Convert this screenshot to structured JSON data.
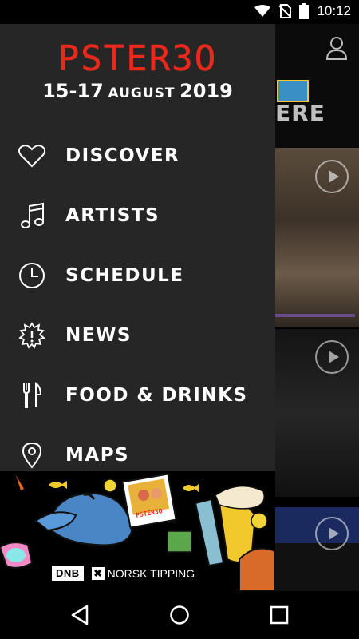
{
  "status_bar": {
    "time": "10:12",
    "icons": [
      "wifi-icon",
      "no-sim-icon",
      "battery-icon"
    ]
  },
  "background": {
    "header_text": "ERE",
    "icons": [
      "user-icon",
      "play-icon",
      "play-icon",
      "play-icon"
    ]
  },
  "drawer": {
    "logo": "PSTER3O",
    "dates": {
      "days": "15-17",
      "month": "AUGUST",
      "year": "2019"
    },
    "menu": [
      {
        "label": "DISCOVER",
        "icon": "heart-icon"
      },
      {
        "label": "ARTISTS",
        "icon": "music-note-icon"
      },
      {
        "label": "SCHEDULE",
        "icon": "clock-icon"
      },
      {
        "label": "NEWS",
        "icon": "news-burst-icon"
      },
      {
        "label": "FOOD & DRINKS",
        "icon": "fork-knife-icon"
      },
      {
        "label": "MAPS",
        "icon": "map-pin-icon"
      }
    ],
    "promo": {
      "sticker_text": "PSTER3O",
      "sponsors": {
        "dnb": "DNB",
        "norsk_tipping": "NORSK TIPPING"
      }
    }
  },
  "colors": {
    "drawer_bg": "#262626",
    "logo_red": "#e8291c",
    "text": "#ffffff"
  },
  "nav_bar": {
    "buttons": [
      "back-icon",
      "home-icon",
      "recents-icon"
    ]
  }
}
